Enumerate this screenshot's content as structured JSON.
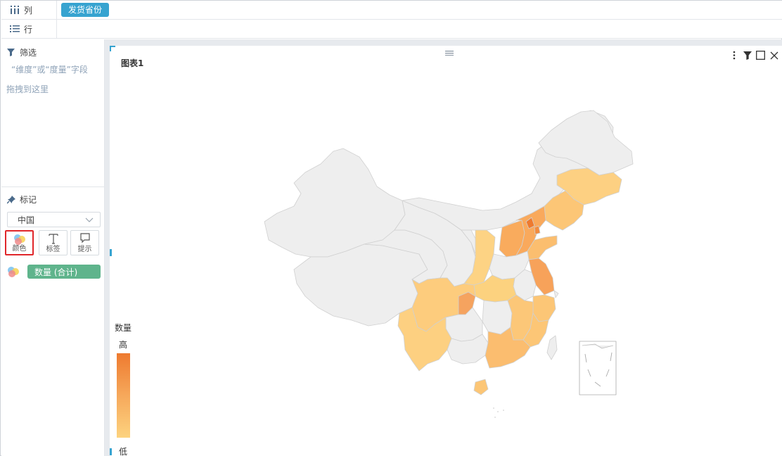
{
  "shelves": {
    "columns": {
      "label": "列",
      "field": "发货省份"
    },
    "rows": {
      "label": "行"
    }
  },
  "filter": {
    "title": "筛选",
    "hint_line1": "“维度”或“度量”字段",
    "hint_line2": "拖拽到这里"
  },
  "marks": {
    "title": "标记",
    "map_select": "中国",
    "buttons": {
      "color": "颜色",
      "label": "标签",
      "tooltip": "提示"
    },
    "color_field": "数量 (合计)"
  },
  "chart": {
    "title": "图表1",
    "legend": {
      "title": "数量",
      "high": "高",
      "low": "低"
    }
  },
  "chart_data": {
    "type": "choropleth-map",
    "map": "中国",
    "dimension": "发货省份",
    "measure": "数量 (合计)",
    "color_range": {
      "low": "#fdd37f",
      "high": "#ee7a2f"
    },
    "no_data_color": "#eeeeee"
  },
  "colors": {
    "accent_blue": "#36a3d0",
    "green_pill": "#5fb48c",
    "selected_border": "#e0262a"
  },
  "icons": {
    "columns": "columns-icon",
    "rows": "list-icon",
    "filter": "filter-icon",
    "marks": "pin-icon",
    "menu": "more-vertical-icon",
    "chart_filter": "filter-icon",
    "maximize": "square-icon",
    "close": "close-icon"
  }
}
